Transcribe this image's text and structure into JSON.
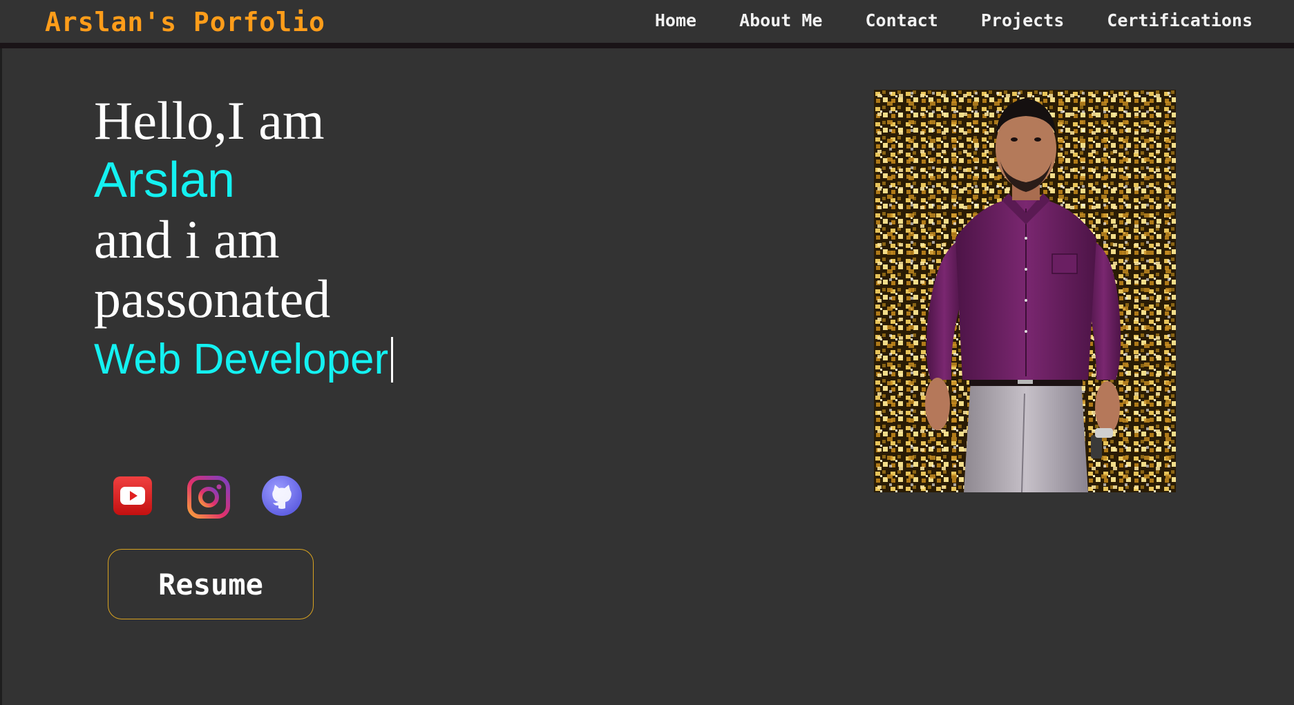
{
  "header": {
    "brand": "Arslan's Porfolio",
    "nav": [
      "Home",
      "About Me",
      "Contact",
      "Projects",
      "Certifications"
    ]
  },
  "hero": {
    "line1": "Hello,I am",
    "name": "Arslan",
    "line3": "and i am",
    "line4": "passonated",
    "role": "Web Developer"
  },
  "socials": [
    {
      "icon": "youtube-icon"
    },
    {
      "icon": "instagram-icon"
    },
    {
      "icon": "github-icon"
    }
  ],
  "resume_label": "Resume",
  "colors": {
    "background": "#333333",
    "brand": "#ff9d1a",
    "accent": "#14f1f1",
    "button_border": "#d9a320",
    "photo_shirt": "#6b2163"
  }
}
